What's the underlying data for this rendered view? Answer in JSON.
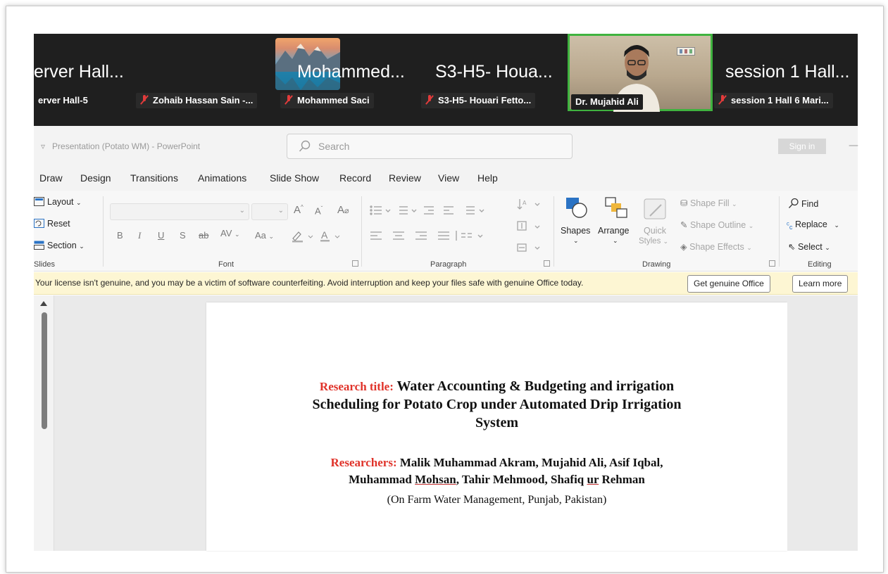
{
  "zoom": {
    "tiles": [
      {
        "title": "erver Hall...",
        "label": "erver Hall-5",
        "muted": false
      },
      {
        "title": "",
        "label": "Zohaib Hassan Sain -...",
        "muted": true
      },
      {
        "title": "Mohammed...",
        "label": "Mohammed Saci",
        "muted": true
      },
      {
        "title": "S3-H5- Houa...",
        "label": "S3-H5- Houari Fetto...",
        "muted": true
      },
      {
        "title": "",
        "label": "Dr. Mujahid Ali",
        "muted": false
      },
      {
        "title": "session 1 Hall...",
        "label": "session 1 Hall 6 Mari...",
        "muted": true
      }
    ],
    "active_speaker_color": "#3fb33f"
  },
  "ppt": {
    "window_title": "Presentation (Potato WM)  -  PowerPoint",
    "search_placeholder": "Search",
    "sign_in": "Sign in",
    "minimize": "—",
    "menu_tabs": [
      "Draw",
      "Design",
      "Transitions",
      "Animations",
      "Slide Show",
      "Record",
      "Review",
      "View",
      "Help"
    ],
    "ribbon": {
      "slides": {
        "layout": "Layout",
        "reset": "Reset",
        "section": "Section",
        "group": "Slides"
      },
      "font": {
        "group": "Font",
        "bold": "B",
        "italic": "I",
        "underline": "U",
        "shadow": "S",
        "strike": "ab",
        "spacing": "AV",
        "case": "Aa"
      },
      "paragraph": {
        "group": "Paragraph"
      },
      "drawing": {
        "group": "Drawing",
        "shapes": "Shapes",
        "arrange": "Arrange",
        "quick_styles_1": "Quick",
        "quick_styles_2": "Styles",
        "shape_fill": "Shape Fill",
        "shape_outline": "Shape Outline",
        "shape_effects": "Shape Effects"
      },
      "editing": {
        "group": "Editing",
        "find": "Find",
        "replace": "Replace",
        "select": "Select"
      }
    },
    "license": {
      "message": "Your license isn't genuine, and you may be a victim of software counterfeiting. Avoid interruption and keep your files safe with genuine Office today.",
      "get_genuine": "Get genuine Office",
      "learn_more": "Learn more"
    },
    "slide": {
      "title_label": "Research title:",
      "title_line1": "Water Accounting & Budgeting and irrigation",
      "title_line2": "Scheduling for Potato Crop under Automated Drip Irrigation",
      "title_line3": "System",
      "researchers_label": "Researchers:",
      "researchers_line1": "Malik Muhammad Akram, Mujahid Ali, Asif Iqbal,",
      "researchers_line2_a": "Muhammad ",
      "researchers_line2_b": "Mohsan",
      "researchers_line2_c": ", Tahir Mehmood, Shafiq ",
      "researchers_line2_d": "ur",
      "researchers_line2_e": " Rehman",
      "affiliation": "(On Farm Water Management, Punjab, Pakistan)"
    },
    "accent_red": "#e0332a",
    "license_bg": "#fdf6d3"
  }
}
